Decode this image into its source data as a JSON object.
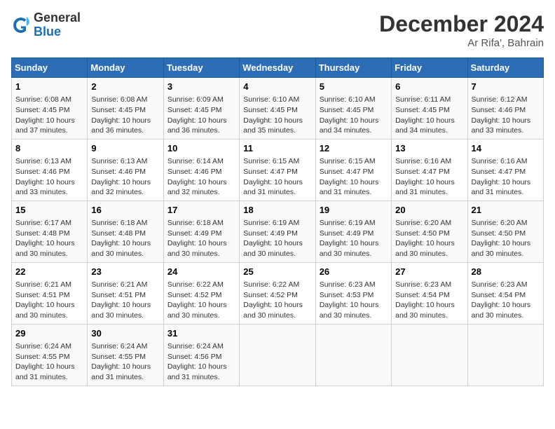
{
  "header": {
    "logo_line1": "General",
    "logo_line2": "Blue",
    "month": "December 2024",
    "location": "Ar Rifa', Bahrain"
  },
  "days_of_week": [
    "Sunday",
    "Monday",
    "Tuesday",
    "Wednesday",
    "Thursday",
    "Friday",
    "Saturday"
  ],
  "weeks": [
    [
      {
        "day": "1",
        "sunrise": "6:08 AM",
        "sunset": "4:45 PM",
        "daylight": "10 hours and 37 minutes."
      },
      {
        "day": "2",
        "sunrise": "6:08 AM",
        "sunset": "4:45 PM",
        "daylight": "10 hours and 36 minutes."
      },
      {
        "day": "3",
        "sunrise": "6:09 AM",
        "sunset": "4:45 PM",
        "daylight": "10 hours and 36 minutes."
      },
      {
        "day": "4",
        "sunrise": "6:10 AM",
        "sunset": "4:45 PM",
        "daylight": "10 hours and 35 minutes."
      },
      {
        "day": "5",
        "sunrise": "6:10 AM",
        "sunset": "4:45 PM",
        "daylight": "10 hours and 34 minutes."
      },
      {
        "day": "6",
        "sunrise": "6:11 AM",
        "sunset": "4:45 PM",
        "daylight": "10 hours and 34 minutes."
      },
      {
        "day": "7",
        "sunrise": "6:12 AM",
        "sunset": "4:46 PM",
        "daylight": "10 hours and 33 minutes."
      }
    ],
    [
      {
        "day": "8",
        "sunrise": "6:13 AM",
        "sunset": "4:46 PM",
        "daylight": "10 hours and 33 minutes."
      },
      {
        "day": "9",
        "sunrise": "6:13 AM",
        "sunset": "4:46 PM",
        "daylight": "10 hours and 32 minutes."
      },
      {
        "day": "10",
        "sunrise": "6:14 AM",
        "sunset": "4:46 PM",
        "daylight": "10 hours and 32 minutes."
      },
      {
        "day": "11",
        "sunrise": "6:15 AM",
        "sunset": "4:47 PM",
        "daylight": "10 hours and 31 minutes."
      },
      {
        "day": "12",
        "sunrise": "6:15 AM",
        "sunset": "4:47 PM",
        "daylight": "10 hours and 31 minutes."
      },
      {
        "day": "13",
        "sunrise": "6:16 AM",
        "sunset": "4:47 PM",
        "daylight": "10 hours and 31 minutes."
      },
      {
        "day": "14",
        "sunrise": "6:16 AM",
        "sunset": "4:47 PM",
        "daylight": "10 hours and 31 minutes."
      }
    ],
    [
      {
        "day": "15",
        "sunrise": "6:17 AM",
        "sunset": "4:48 PM",
        "daylight": "10 hours and 30 minutes."
      },
      {
        "day": "16",
        "sunrise": "6:18 AM",
        "sunset": "4:48 PM",
        "daylight": "10 hours and 30 minutes."
      },
      {
        "day": "17",
        "sunrise": "6:18 AM",
        "sunset": "4:49 PM",
        "daylight": "10 hours and 30 minutes."
      },
      {
        "day": "18",
        "sunrise": "6:19 AM",
        "sunset": "4:49 PM",
        "daylight": "10 hours and 30 minutes."
      },
      {
        "day": "19",
        "sunrise": "6:19 AM",
        "sunset": "4:49 PM",
        "daylight": "10 hours and 30 minutes."
      },
      {
        "day": "20",
        "sunrise": "6:20 AM",
        "sunset": "4:50 PM",
        "daylight": "10 hours and 30 minutes."
      },
      {
        "day": "21",
        "sunrise": "6:20 AM",
        "sunset": "4:50 PM",
        "daylight": "10 hours and 30 minutes."
      }
    ],
    [
      {
        "day": "22",
        "sunrise": "6:21 AM",
        "sunset": "4:51 PM",
        "daylight": "10 hours and 30 minutes."
      },
      {
        "day": "23",
        "sunrise": "6:21 AM",
        "sunset": "4:51 PM",
        "daylight": "10 hours and 30 minutes."
      },
      {
        "day": "24",
        "sunrise": "6:22 AM",
        "sunset": "4:52 PM",
        "daylight": "10 hours and 30 minutes."
      },
      {
        "day": "25",
        "sunrise": "6:22 AM",
        "sunset": "4:52 PM",
        "daylight": "10 hours and 30 minutes."
      },
      {
        "day": "26",
        "sunrise": "6:23 AM",
        "sunset": "4:53 PM",
        "daylight": "10 hours and 30 minutes."
      },
      {
        "day": "27",
        "sunrise": "6:23 AM",
        "sunset": "4:54 PM",
        "daylight": "10 hours and 30 minutes."
      },
      {
        "day": "28",
        "sunrise": "6:23 AM",
        "sunset": "4:54 PM",
        "daylight": "10 hours and 30 minutes."
      }
    ],
    [
      {
        "day": "29",
        "sunrise": "6:24 AM",
        "sunset": "4:55 PM",
        "daylight": "10 hours and 31 minutes."
      },
      {
        "day": "30",
        "sunrise": "6:24 AM",
        "sunset": "4:55 PM",
        "daylight": "10 hours and 31 minutes."
      },
      {
        "day": "31",
        "sunrise": "6:24 AM",
        "sunset": "4:56 PM",
        "daylight": "10 hours and 31 minutes."
      },
      null,
      null,
      null,
      null
    ]
  ]
}
